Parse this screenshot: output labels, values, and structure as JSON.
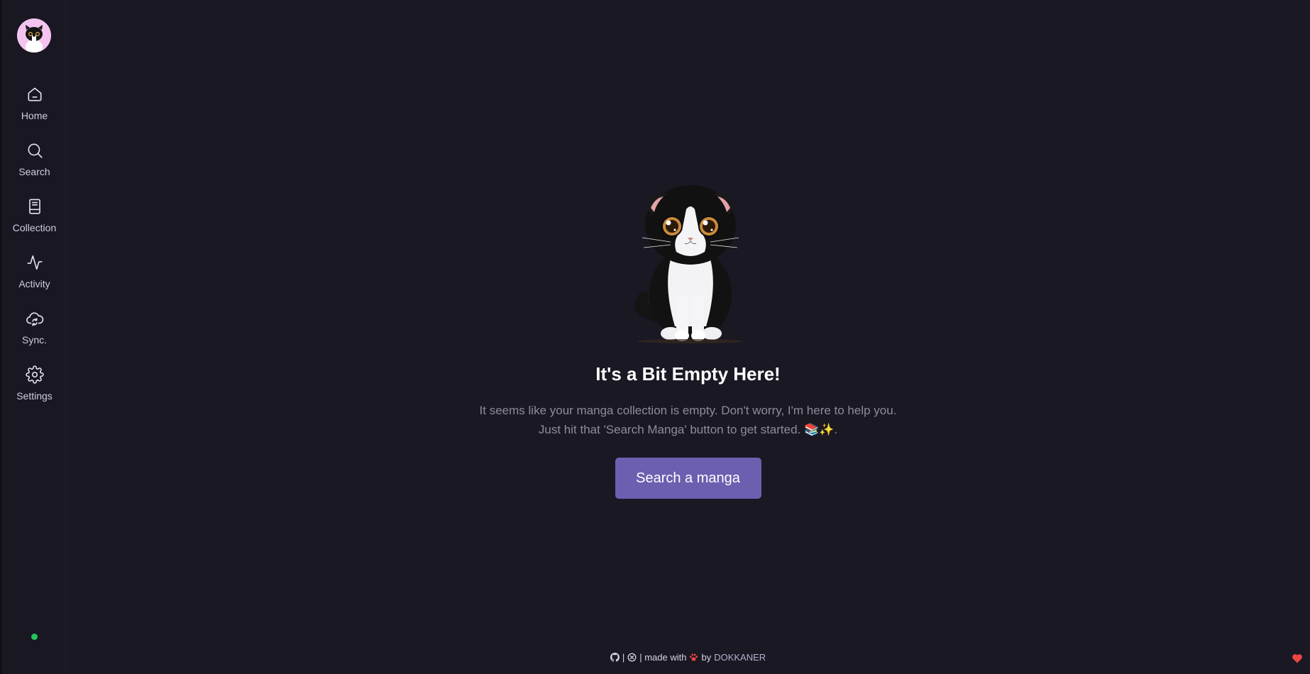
{
  "sidebar": {
    "logo_icon": "cat-avatar-logo",
    "items": [
      {
        "label": "Home",
        "icon": "home-icon"
      },
      {
        "label": "Search",
        "icon": "search-icon"
      },
      {
        "label": "Collection",
        "icon": "book-icon"
      },
      {
        "label": "Activity",
        "icon": "activity-icon"
      },
      {
        "label": "Sync.",
        "icon": "cloud-sync-icon"
      },
      {
        "label": "Settings",
        "icon": "gear-icon"
      }
    ],
    "status_color": "#22c55e"
  },
  "main": {
    "illustration": "scottish-fold-cat",
    "title": "It's a Bit Empty Here!",
    "description_line1": "It seems like your manga collection is empty. Don't worry, I'm here to help you.",
    "description_line2": "Just hit that 'Search Manga' button to get started. 📚✨.",
    "button_label": "Search a manga"
  },
  "footer": {
    "separator1": "|",
    "separator2": "| made with",
    "by": "by",
    "author": "DOKKANER",
    "icons": [
      "github-icon",
      "open-collective-icon",
      "paw-icon",
      "heart-icon"
    ]
  },
  "colors": {
    "background": "#1a1823",
    "accent": "#6c5fb0",
    "heart": "#ef4444"
  }
}
